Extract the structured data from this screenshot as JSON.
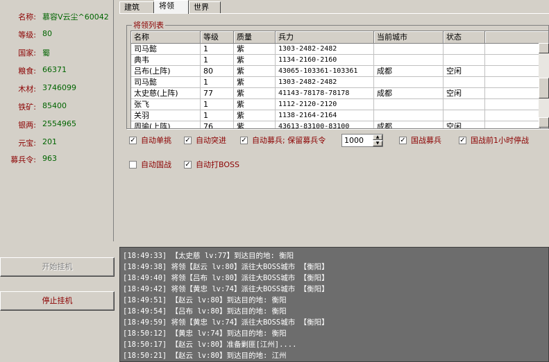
{
  "stats": [
    {
      "label": "名称:",
      "value": "慕容V云尘^60042"
    },
    {
      "label": "等级:",
      "value": "80"
    },
    {
      "label": "国家:",
      "value": "蜀"
    },
    {
      "label": "粮食:",
      "value": "66371"
    },
    {
      "label": "木材:",
      "value": "3746099"
    },
    {
      "label": "铁矿:",
      "value": "85400"
    },
    {
      "label": "银两:",
      "value": "2554965"
    },
    {
      "label": "元宝:",
      "value": "201"
    },
    {
      "label": "募兵令:",
      "value": "963"
    }
  ],
  "buttons": {
    "start": "开始挂机",
    "stop": "停止挂机"
  },
  "tabs": [
    "建筑",
    "将领",
    "世界"
  ],
  "selected_tab": "将领",
  "group_title": "将领列表",
  "columns": [
    "名称",
    "等级",
    "质量",
    "兵力",
    "当前城市",
    "状态"
  ],
  "rows": [
    [
      "司马懿",
      "1",
      "紫",
      "1303-2482-2482",
      "",
      ""
    ],
    [
      "典韦",
      "1",
      "紫",
      "1134-2160-2160",
      "",
      ""
    ],
    [
      "吕布(上阵)",
      "80",
      "紫",
      "43065-103361-103361",
      "成都",
      "空闲"
    ],
    [
      "司马懿",
      "1",
      "紫",
      "1303-2482-2482",
      "",
      ""
    ],
    [
      "太史慈(上阵)",
      "77",
      "紫",
      "41143-78178-78178",
      "成都",
      "空闲"
    ],
    [
      "张飞",
      "1",
      "紫",
      "1112-2120-2120",
      "",
      ""
    ],
    [
      "关羽",
      "1",
      "紫",
      "1138-2164-2164",
      "",
      ""
    ],
    [
      "周瑜(上阵)",
      "76",
      "紫",
      "43613-83100-83100",
      "成都",
      "空闲"
    ]
  ],
  "options": [
    {
      "label": "自动单挑",
      "checked": true
    },
    {
      "label": "自动突进",
      "checked": true
    },
    {
      "label": "自动募兵; 保留募兵令",
      "checked": true
    },
    {
      "label": "国战募兵",
      "checked": true
    },
    {
      "label": "国战前1小时停战",
      "checked": true
    },
    {
      "label": "自动国战",
      "checked": false
    },
    {
      "label": "自动打BOSS",
      "checked": true
    }
  ],
  "reserve_value": "1000",
  "log": [
    "[18:49:33] 【太史慈 lv:77】到达目的地: 衡阳",
    "[18:49:38] 将领【赵云 lv:80】派往大BOSS城市 【衡阳】",
    "[18:49:40] 将领【吕布 lv:80】派往大BOSS城市 【衡阳】",
    "[18:49:42] 将领【黄忠 lv:74】派往大BOSS城市 【衡阳】",
    "[18:49:51] 【赵云 lv:80】到达目的地: 衡阳",
    "[18:49:54] 【吕布 lv:80】到达目的地: 衡阳",
    "[18:49:59] 将领【黄忠 lv:74】派往大BOSS城市 【衡阳】",
    "[18:50:12] 【黄忠 lv:74】到达目的地: 衡阳",
    "[18:50:17] 【赵云 lv:80】准备剿匪[江州]....",
    "[18:50:21] 【赵云 lv:80】到达目的地: 江州"
  ]
}
